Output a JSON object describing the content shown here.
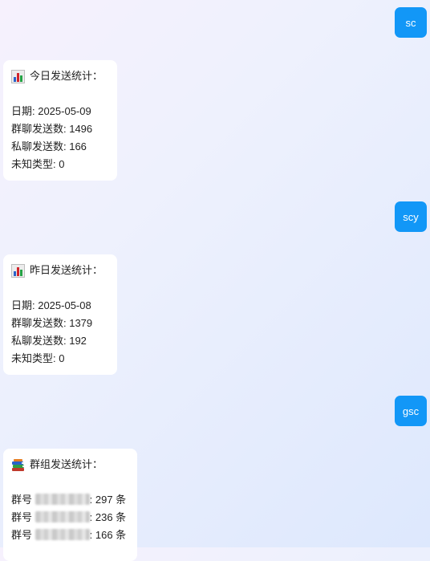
{
  "messages": [
    {
      "role": "user",
      "text": "sc"
    },
    {
      "role": "bot",
      "header": "今日发送统计：",
      "icon": "bar-chart-icon",
      "lines": [
        "日期: 2025-05-09",
        "群聊发送数: 1496",
        "私聊发送数: 166",
        "未知类型: 0"
      ]
    },
    {
      "role": "user",
      "text": "scy"
    },
    {
      "role": "bot",
      "header": "昨日发送统计：",
      "icon": "bar-chart-icon",
      "lines": [
        "日期: 2025-05-08",
        "群聊发送数: 1379",
        "私聊发送数: 192",
        "未知类型: 0"
      ]
    },
    {
      "role": "user",
      "text": "gsc"
    },
    {
      "role": "bot",
      "header": "群组发送统计：",
      "icon": "books-icon",
      "groups": [
        {
          "prefix": "群号",
          "count": ": 297 条"
        },
        {
          "prefix": "群号",
          "count": ": 236 条"
        },
        {
          "prefix": "群号",
          "count": ": 166 条"
        }
      ]
    }
  ],
  "colors": {
    "user_bubble": "#1297f7",
    "bot_bubble": "#ffffff",
    "text": "#222222"
  }
}
